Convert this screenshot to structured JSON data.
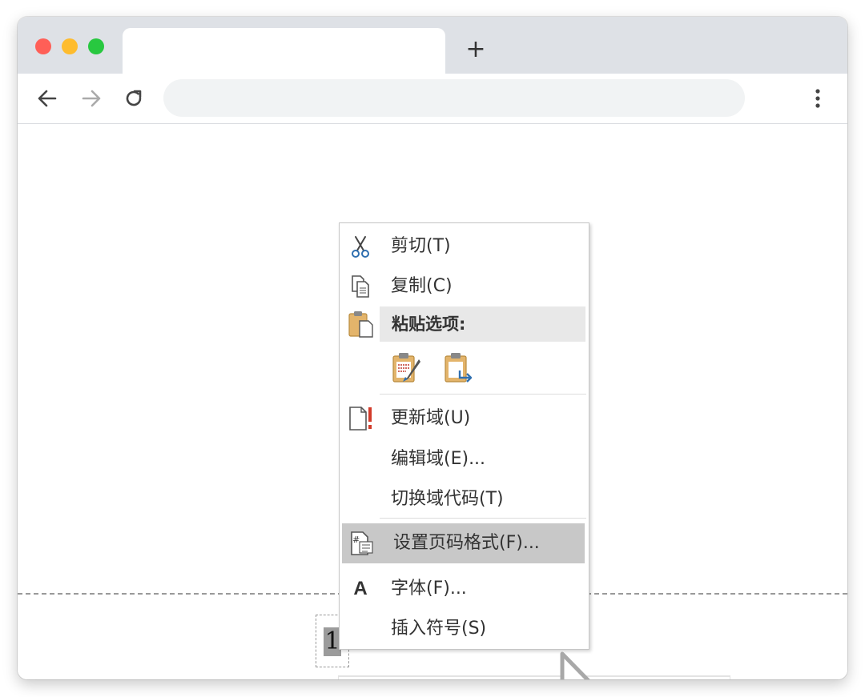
{
  "browser": {
    "new_tab_label": "+",
    "icons": [
      "back-arrow-icon",
      "forward-arrow-icon",
      "reload-icon",
      "more-vert-icon"
    ]
  },
  "document": {
    "page_number": "1"
  },
  "context_menu": {
    "items": [
      {
        "label": "剪切(T)",
        "icon": "scissors-icon"
      },
      {
        "label": "复制(C)",
        "icon": "copy-icon"
      },
      {
        "label": "粘贴选项:",
        "icon": "paste-icon"
      },
      {
        "label": "更新域(U)",
        "icon": "update-field-icon"
      },
      {
        "label": "编辑域(E)...",
        "icon": ""
      },
      {
        "label": "切换域代码(T)",
        "icon": ""
      },
      {
        "label": "设置页码格式(F)...",
        "icon": "page-number-format-icon",
        "highlighted": true
      },
      {
        "label": "字体(F)...",
        "icon": "font-icon"
      },
      {
        "label": "插入符号(S)",
        "icon": ""
      }
    ],
    "paste_options": [
      "keep-source-formatting-icon",
      "merge-formatting-icon"
    ],
    "font_icon_glyph": "A"
  },
  "colors": {
    "titlebar": "#dee1e6",
    "address_bar": "#f1f3f4",
    "menu_hover": "#c8c8c8",
    "cursor_accent": "#f0a800"
  }
}
